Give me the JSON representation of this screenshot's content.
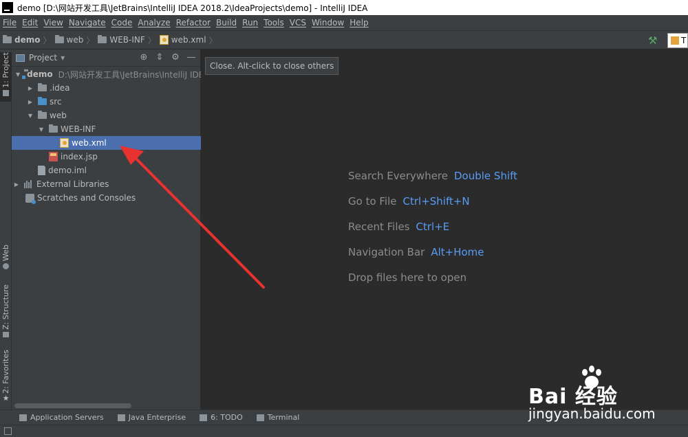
{
  "window": {
    "title": "demo [D:\\网站开发工具\\JetBrains\\IntelliJ IDEA 2018.2\\IdeaProjects\\demo] - IntelliJ IDEA"
  },
  "menu": [
    "File",
    "Edit",
    "View",
    "Navigate",
    "Code",
    "Analyze",
    "Refactor",
    "Build",
    "Run",
    "Tools",
    "VCS",
    "Window",
    "Help"
  ],
  "breadcrumb": [
    "demo",
    "web",
    "WEB-INF",
    "web.xml"
  ],
  "run_config_label": "T",
  "left_tabs": {
    "project": "1: Project",
    "web": "Web",
    "structure": "Z: Structure",
    "favorites": "2: Favorites"
  },
  "project_panel": {
    "title": "Project",
    "tree": [
      {
        "label": "demo",
        "path": "D:\\网站开发工具\\JetBrains\\IntelliJ IDEA"
      },
      {
        "label": ".idea"
      },
      {
        "label": "src"
      },
      {
        "label": "web"
      },
      {
        "label": "WEB-INF"
      },
      {
        "label": "web.xml"
      },
      {
        "label": "index.jsp"
      },
      {
        "label": "demo.iml"
      },
      {
        "label": "External Libraries"
      },
      {
        "label": "Scratches and Consoles"
      }
    ],
    "selected": "web.xml"
  },
  "tooltip": "Close. Alt-click to close others",
  "editor_hints": [
    {
      "text": "Search Everywhere",
      "key": "Double Shift"
    },
    {
      "text": "Go to File",
      "key": "Ctrl+Shift+N"
    },
    {
      "text": "Recent Files",
      "key": "Ctrl+E"
    },
    {
      "text": "Navigation Bar",
      "key": "Alt+Home"
    },
    {
      "text": "Drop files here to open",
      "key": ""
    }
  ],
  "bottom_tabs": [
    "Application Servers",
    "Java Enterprise",
    "6: TODO",
    "Terminal"
  ],
  "watermark": {
    "brand": "Bai 经验",
    "site": "jingyan.baidu.com"
  },
  "colors": {
    "selection": "#4b6eaf",
    "hint_key": "#589df6",
    "arrow": "#e8322f"
  }
}
